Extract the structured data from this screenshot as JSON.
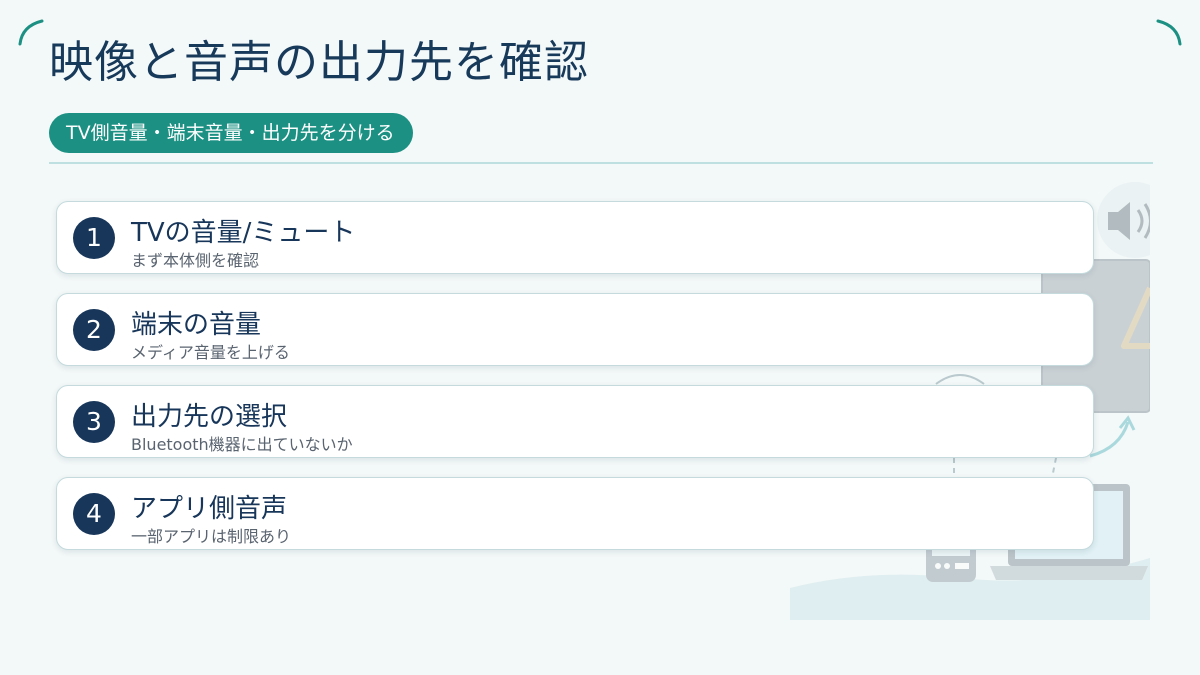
{
  "page": {
    "title": "映像と音声の出力先を確認",
    "subtitle_pill": "TV側音量・端末音量・出力先を分ける"
  },
  "steps": [
    {
      "number": "1",
      "title": "TVの音量/ミュート",
      "subtitle": "まず本体側を確認"
    },
    {
      "number": "2",
      "title": "端末の音量",
      "subtitle": "メディア音量を上げる"
    },
    {
      "number": "3",
      "title": "出力先の選択",
      "subtitle": "Bluetooth機器に出ていないか"
    },
    {
      "number": "4",
      "title": "アプリ側音声",
      "subtitle": "一部アプリは制限あり"
    }
  ],
  "illustration": {
    "icons": [
      "speaker-icon",
      "warning-icon",
      "wifi-icon",
      "phone-icon",
      "laptop-icon",
      "arrow-icon"
    ]
  },
  "colors": {
    "background": "#f3f8f8",
    "title": "#17395a",
    "accent": "#1b9083",
    "number_badge": "#17365a",
    "divider": "#bfe0e0"
  }
}
